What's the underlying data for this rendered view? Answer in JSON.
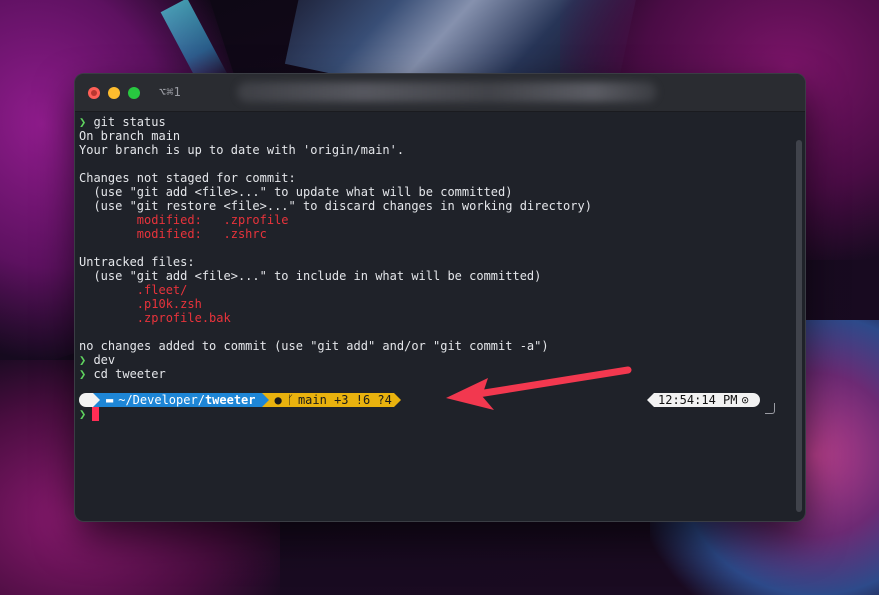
{
  "window": {
    "shortcut": "⌥⌘1"
  },
  "terminal": {
    "lines": [
      {
        "prompt": true,
        "text": "git status"
      },
      {
        "text": "On branch main"
      },
      {
        "text": "Your branch is up to date with 'origin/main'."
      },
      {
        "text": ""
      },
      {
        "text": "Changes not staged for commit:"
      },
      {
        "text": "  (use \"git add <file>...\" to update what will be committed)"
      },
      {
        "text": "  (use \"git restore <file>...\" to discard changes in working directory)"
      },
      {
        "text": "        modified:   .zprofile",
        "red": true
      },
      {
        "text": "        modified:   .zshrc",
        "red": true
      },
      {
        "text": ""
      },
      {
        "text": "Untracked files:"
      },
      {
        "text": "  (use \"git add <file>...\" to include in what will be committed)"
      },
      {
        "text": "        .fleet/",
        "red": true
      },
      {
        "text": "        .p10k.zsh",
        "red": true
      },
      {
        "text": "        .zprofile.bak",
        "red": true
      },
      {
        "text": ""
      },
      {
        "text": "no changes added to commit (use \"git add\" and/or \"git commit -a\")"
      },
      {
        "prompt": true,
        "text": "dev"
      },
      {
        "prompt": true,
        "text": "cd tweeter"
      }
    ],
    "prompt_char": "❯"
  },
  "powerline": {
    "apple_glyph": "",
    "dir_prefix": "~/Developer/",
    "dir_name": "tweeter",
    "git_status": "main +3 !6 ?4",
    "time": "12:54:14 PM"
  },
  "colors": {
    "prompt": "#5fd35f",
    "dir_segment": "#1e86d6",
    "git_segment": "#e9b20e",
    "modified_text": "#e8333b",
    "cursor": "#ff2d55",
    "annotation_arrow": "#f2384f"
  }
}
